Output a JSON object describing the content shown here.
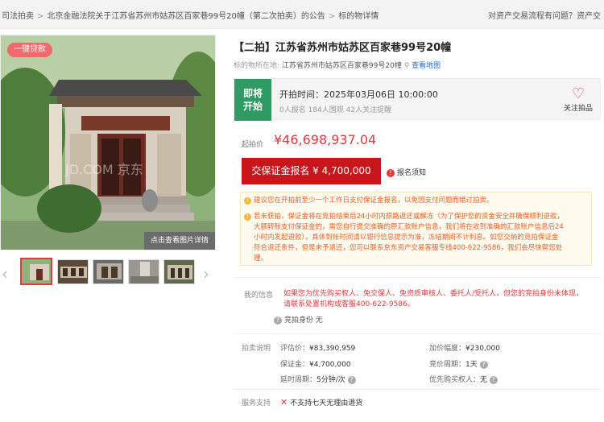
{
  "breadcrumb": {
    "items": [
      "司法拍卖",
      "北京金融法院关于江苏省苏州市姑苏区百家巷99号20幢（第二次拍卖）的公告",
      "标的物详情"
    ],
    "separator": ">"
  },
  "help_text": "对资产交易流程有问题？资产交",
  "gallery": {
    "badge": "一键贷款",
    "view_detail": "点击查看图片详情",
    "watermark": "JD.COM 京东",
    "thumbnails_count": 5,
    "active_thumbnail": 0
  },
  "listing": {
    "title": "【二拍】江苏省苏州市姑苏区百家巷99号20幢",
    "location_label": "标的物所在地:",
    "location_value": "江苏省苏州市姑苏区百家巷99号20幢",
    "map_link": "查看地图"
  },
  "status": {
    "label_line1": "即将",
    "label_line2": "开始",
    "start_time": "开拍时间：2025年03月06日 10:00:00",
    "counts": "0人报名    184人围观    42人关注提醒",
    "follow_label": "关注拍品"
  },
  "price": {
    "label": "起拍价",
    "value": "¥46,698,937.04"
  },
  "deposit": {
    "button": "交保证金报名 ¥ 4,700,000",
    "notice": "报名须知"
  },
  "tips": [
    "建议您在开拍前至少一个工作日支付保证金报名，以免因支付问题而错过拍卖。",
    "若未获拍，保证金将在竞拍结束后24小时内原路返还或解冻（为了保护您的资金安全并确保顺利退款，",
    "大额转账支付保证金的，需您自行提交准确的原汇款账户信息，我们将在收到准确的汇款账户信息后24",
    "小时内发起退款），具体到账时间请以银行信息提示为准，冻结期间不计利息。如您交纳的竞拍保证金",
    "符合退还条件，但是未予退还，您可以联系京东资产交易客服专线400-622-9586，我们会尽快帮您处",
    "理。"
  ],
  "my_info": {
    "label": "我的信息",
    "text_line1": "如果您为优先购买权人、免交保人、免资质审核人、委托人/受托人，但您的竞拍身份未体现，",
    "text_line2": "请联系处置机构或客服400-622-9586。",
    "bid_identity": "竞拍身份  无"
  },
  "auction": {
    "label": "拍卖说明",
    "appraisal": {
      "k": "评估价：",
      "v": "¥83,390,959"
    },
    "increment": {
      "k": "加价幅度：",
      "v": "¥230,000"
    },
    "deposit": {
      "k": "保证金：",
      "v": "¥4,700,000"
    },
    "cycle": {
      "k": "竞价周期：",
      "v": "1天"
    },
    "delay": {
      "k": "延时周期：",
      "v": "5分钟/次"
    },
    "priority": {
      "k": "优先购买权人：",
      "v": "无"
    }
  },
  "service": {
    "label": "服务支持",
    "text": "不支持七天无理由退货"
  },
  "colors": {
    "accent": "#e4393c",
    "status_green": "#2f9a63",
    "tip_orange": "#e8622a"
  }
}
